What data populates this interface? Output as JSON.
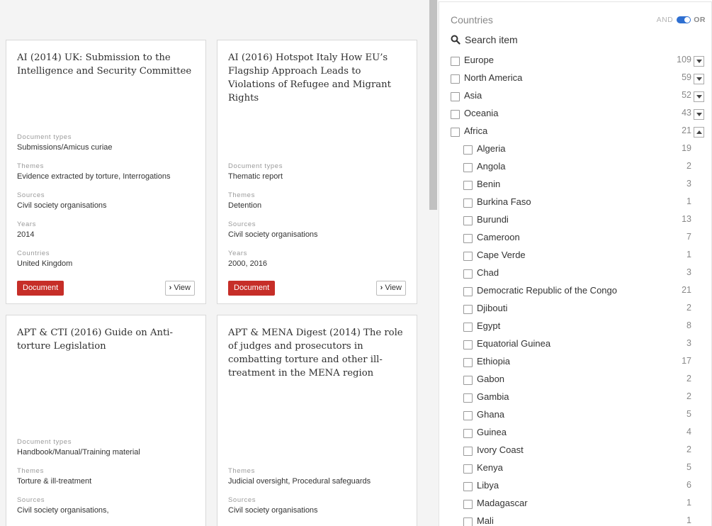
{
  "cards": [
    {
      "title": "AI (2014) UK: Submission to the Intelligence and Security Committee",
      "fields": [
        {
          "label": "Document types",
          "value": "Submissions/Amicus curiae"
        },
        {
          "label": "Themes",
          "value": "Evidence extracted by torture, Interrogations"
        },
        {
          "label": "Sources",
          "value": "Civil society organisations"
        },
        {
          "label": "Years",
          "value": "2014"
        },
        {
          "label": "Countries",
          "value": "United Kingdom"
        }
      ],
      "badge": "Document",
      "view_label": "View"
    },
    {
      "title": "AI (2016) Hotspot Italy How EU’s Flagship Approach Leads to Violations of Refugee and Migrant Rights",
      "fields": [
        {
          "label": "Document types",
          "value": "Thematic report"
        },
        {
          "label": "Themes",
          "value": "Detention"
        },
        {
          "label": "Sources",
          "value": "Civil society organisations"
        },
        {
          "label": "Years",
          "value": "2000, 2016"
        }
      ],
      "badge": "Document",
      "view_label": "View"
    },
    {
      "title": "APT & CTI (2016) Guide on Anti-torture Legislation",
      "fields": [
        {
          "label": "Document types",
          "value": "Handbook/Manual/Training material"
        },
        {
          "label": "Themes",
          "value": "Torture & ill-treatment"
        },
        {
          "label": "Sources",
          "value": "Civil society organisations,"
        }
      ]
    },
    {
      "title": "APT & MENA Digest (2014) The role of judges and prosecutors in combatting torture and other ill-treatment in the MENA region",
      "fields": [
        {
          "label": "Themes",
          "value": "Judicial oversight, Procedural safeguards"
        },
        {
          "label": "Sources",
          "value": "Civil society organisations"
        }
      ]
    }
  ],
  "filter": {
    "title": "Countries",
    "and_label": "AND",
    "or_label": "OR",
    "search_label": "Search item",
    "toggle_color": "#2e6fd1",
    "regions": [
      {
        "label": "Europe",
        "count": "109",
        "expanded": false
      },
      {
        "label": "North America",
        "count": "59",
        "expanded": false
      },
      {
        "label": "Asia",
        "count": "52",
        "expanded": false
      },
      {
        "label": "Oceania",
        "count": "43",
        "expanded": false
      },
      {
        "label": "Africa",
        "count": "21",
        "expanded": true
      }
    ],
    "africa_countries": [
      {
        "label": "Algeria",
        "count": "19"
      },
      {
        "label": "Angola",
        "count": "2"
      },
      {
        "label": "Benin",
        "count": "3"
      },
      {
        "label": "Burkina Faso",
        "count": "1"
      },
      {
        "label": "Burundi",
        "count": "13"
      },
      {
        "label": "Cameroon",
        "count": "7"
      },
      {
        "label": "Cape Verde",
        "count": "1"
      },
      {
        "label": "Chad",
        "count": "3"
      },
      {
        "label": "Democratic Republic of the Congo",
        "count": "21"
      },
      {
        "label": "Djibouti",
        "count": "2"
      },
      {
        "label": "Egypt",
        "count": "8"
      },
      {
        "label": "Equatorial Guinea",
        "count": "3"
      },
      {
        "label": "Ethiopia",
        "count": "17"
      },
      {
        "label": "Gabon",
        "count": "2"
      },
      {
        "label": "Gambia",
        "count": "2"
      },
      {
        "label": "Ghana",
        "count": "5"
      },
      {
        "label": "Guinea",
        "count": "4"
      },
      {
        "label": "Ivory Coast",
        "count": "2"
      },
      {
        "label": "Kenya",
        "count": "5"
      },
      {
        "label": "Libya",
        "count": "6"
      },
      {
        "label": "Madagascar",
        "count": "1"
      },
      {
        "label": "Mali",
        "count": "1"
      }
    ]
  }
}
